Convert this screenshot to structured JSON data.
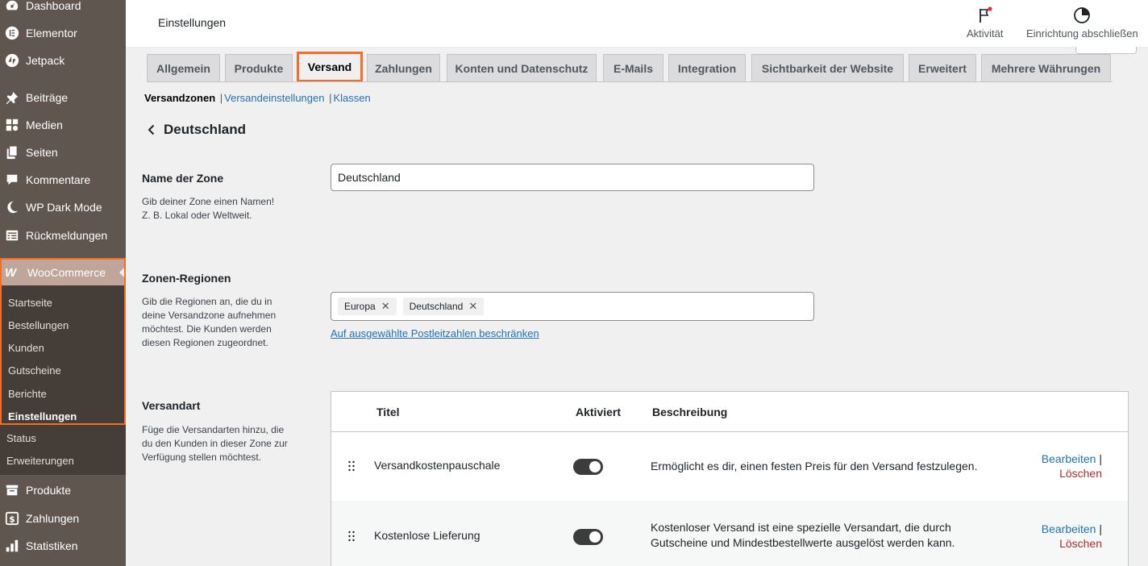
{
  "sidebar": {
    "items_top": [
      {
        "label": "Dashboard",
        "icon": "dashboard-icon"
      },
      {
        "label": "Elementor",
        "icon": "elementor-icon"
      },
      {
        "label": "Jetpack",
        "icon": "jetpack-icon"
      },
      {
        "label": "Beiträge",
        "icon": "pin-icon"
      },
      {
        "label": "Medien",
        "icon": "media-icon"
      },
      {
        "label": "Seiten",
        "icon": "pages-icon"
      },
      {
        "label": "Kommentare",
        "icon": "comment-icon"
      },
      {
        "label": "WP Dark Mode",
        "icon": "moon-icon"
      },
      {
        "label": "Rückmeldungen",
        "icon": "feedback-icon"
      }
    ],
    "woocommerce": {
      "label": "WooCommerce",
      "logo": "W",
      "submenu": [
        "Startseite",
        "Bestellungen",
        "Kunden",
        "Gutscheine",
        "Berichte",
        "Einstellungen",
        "Status",
        "Erweiterungen"
      ],
      "current": "Einstellungen"
    },
    "items_bottom": [
      {
        "label": "Produkte",
        "icon": "products-icon"
      },
      {
        "label": "Zahlungen",
        "icon": "payments-icon"
      },
      {
        "label": "Statistiken",
        "icon": "stats-icon"
      }
    ]
  },
  "topbar": {
    "title": "Einstellungen",
    "activity_label": "Aktivität",
    "setup_label": "Einrichtung abschließen"
  },
  "tabs": [
    "Allgemein",
    "Produkte",
    "Versand",
    "Zahlungen",
    "Konten und Datenschutz",
    "E-Mails",
    "Integration",
    "Sichtbarkeit der Website",
    "Erweitert",
    "Mehrere Währungen"
  ],
  "active_tab": "Versand",
  "subnav": {
    "current": "Versandzonen",
    "links": [
      "Versandeinstellungen",
      "Klassen"
    ]
  },
  "zone_heading": "Deutschland",
  "form": {
    "zone_name": {
      "label": "Name der Zone",
      "desc_line1": "Gib deiner Zone einen Namen!",
      "desc_line2": "Z. B. Lokal oder Weltweit.",
      "value": "Deutschland"
    },
    "regions": {
      "label": "Zonen-Regionen",
      "desc_lines": [
        "Gib die Regionen an, die du in",
        "deine Versandzone aufnehmen",
        "möchtest. Die Kunden werden",
        "diesen Regionen zugeordnet."
      ],
      "chips": [
        "Europa",
        "Deutschland"
      ],
      "postcode_link": "Auf ausgewählte Postleitzahlen beschränken"
    },
    "methods": {
      "label": "Versandart",
      "desc_lines": [
        "Füge die Versandarten hinzu, die",
        "du den Kunden in dieser Zone zur",
        "Verfügung stellen möchtest."
      ]
    }
  },
  "table": {
    "headers": {
      "title": "Titel",
      "enabled": "Aktiviert",
      "description": "Beschreibung"
    },
    "rows": [
      {
        "title": "Versandkostenpauschale",
        "enabled": true,
        "desc_line1": "Ermöglicht es dir, einen festen Preis für den Versand festzulegen.",
        "desc_line2": ""
      },
      {
        "title": "Kostenlose Lieferung",
        "enabled": true,
        "desc_line1": "Kostenloser Versand ist eine spezielle Versandart, die durch",
        "desc_line2": "Gutscheine und Mindestbestellwerte ausgelöst werden kann."
      }
    ],
    "edit_label": "Bearbeiten",
    "separator": "|",
    "delete_label": "Löschen"
  },
  "colors": {
    "accent": "#f56e28",
    "sidebar": "#5f574f",
    "link": "#2271b1",
    "delete": "#b32d2e"
  }
}
